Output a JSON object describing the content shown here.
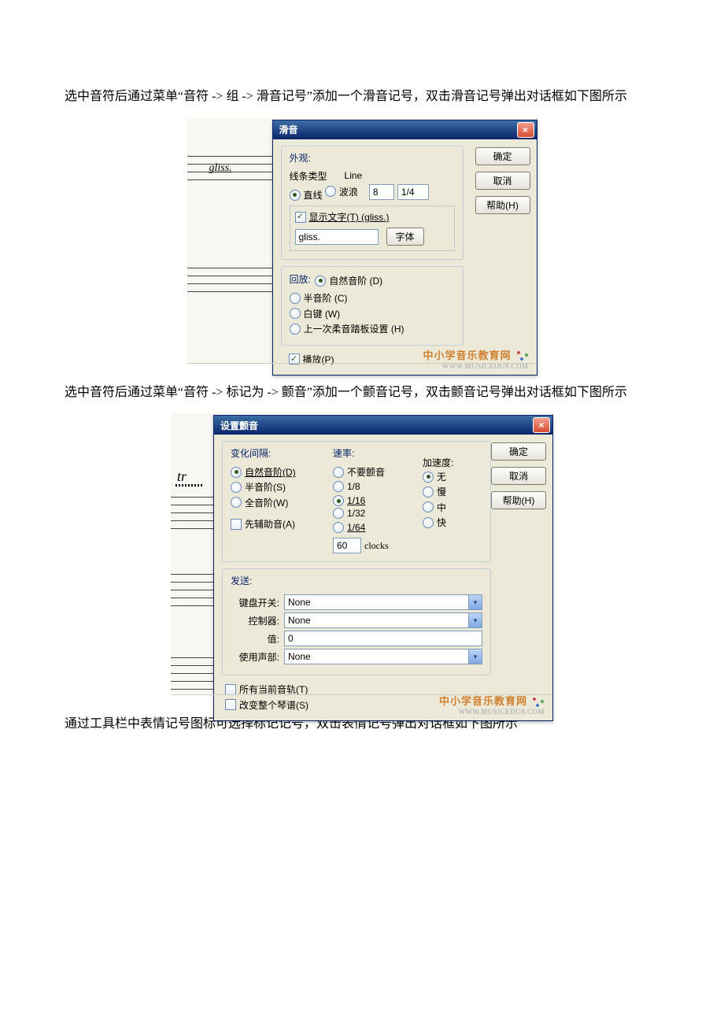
{
  "paragraphs": {
    "p1": "选中音符后通过菜单“音符 -> 组 -> 滑音记号”添加一个滑音记号，双击滑音记号弹出对话框如下图所示",
    "p2": "选中音符后通过菜单“音符 -> 标记为 -> 颤音”添加一个颤音记号，双击颤音记号弹出对话框如下图所示",
    "p3": "通过工具栏中表情记号图标可选择标记记号，双击表情记号弹出对话框如下图所示"
  },
  "staff": {
    "gliss_text": "gliss.",
    "tr_symbol": "tr"
  },
  "gliss_dialog": {
    "title": "滑音",
    "appearance_group": "外观:",
    "line_type_label": "线条类型",
    "line_header": "Line",
    "radio_straight": "直线",
    "radio_wave": "波浪",
    "num_value": "8",
    "fraction": "1/4",
    "show_text_check": "显示文字(T) (gliss.)",
    "text_value": "gliss.",
    "font_button": "字体",
    "playback_group": "回放:",
    "radio_natural": "自然音阶 (D)",
    "radio_chromatic": "半音阶 (C)",
    "radio_white": "白键 (W)",
    "radio_pedal": "上一次柔音踏板设置 (H)",
    "play_check": "播放(P)",
    "buttons": {
      "ok": "确定",
      "cancel": "取消",
      "help": "帮助(H)"
    }
  },
  "trill_dialog": {
    "title": "设置颤音",
    "interval_group": "变化间隔:",
    "radio_diatonic": "自然音阶(D)",
    "radio_semitone": "半音阶(S)",
    "radio_wholetone": "全音阶(W)",
    "pre_aux_check": "先辅助音(A)",
    "rate_group": "速率:",
    "rate_none": "不要颤音",
    "rate_8": "1/8",
    "rate_16": "1/16",
    "rate_32": "1/32",
    "rate_64": "1/64",
    "rate_value": "60",
    "clocks_label": "clocks",
    "accel_label": "加速度:",
    "accel_none": "无",
    "accel_slow": "慢",
    "accel_med": "中",
    "accel_fast": "快",
    "send_group": "发送:",
    "kbd_label": "键盘开关:",
    "ctrl_label": "控制器:",
    "val_label": "值:",
    "voice_label": "使用声部:",
    "none_text": "None",
    "zero_text": "0",
    "all_tracks_check": "所有当前音轨(T)",
    "whole_score_check": "改变整个琴谱(S)",
    "buttons": {
      "ok": "确定",
      "cancel": "取消",
      "help": "帮助(H)"
    }
  },
  "watermark": {
    "line1": "中小学音乐教育网",
    "line2": "WWW.MUSICEDU8.COM"
  }
}
